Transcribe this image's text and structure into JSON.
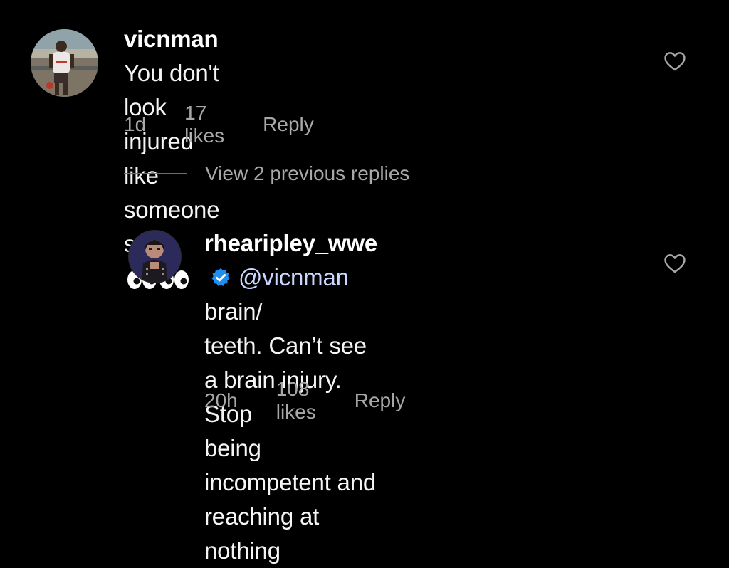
{
  "comments": [
    {
      "username": "vicnman",
      "text_line1": "You don't look injured like someone",
      "text_line2": "said",
      "emoji": "eyes-emoji",
      "time": "1d",
      "likes": "17 likes",
      "reply_label": "Reply"
    }
  ],
  "view_replies": "View 2 previous replies",
  "reply": {
    "username": "rhearipley_wwe",
    "verified": true,
    "mention": "@vicnman",
    "text_line1_rest": "brain/",
    "text_line2": "teeth. Can’t see a brain injury. Stop",
    "text_line3": "being incompetent and reaching at",
    "text_line4": "nothing",
    "time": "20h",
    "likes": "108 likes",
    "reply_label": "Reply"
  },
  "colors": {
    "background": "#000000",
    "text": "#f5f5f5",
    "meta": "#a8a8a8",
    "mention": "#c9d6ff",
    "verified": "#1f8ef1"
  },
  "icons": [
    "heart-outline-icon",
    "verified-badge-icon",
    "eyes-emoji"
  ]
}
